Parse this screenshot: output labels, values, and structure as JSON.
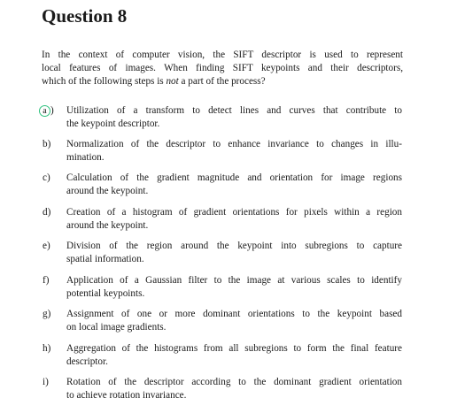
{
  "title": "Question 8",
  "question_lines": [
    "In the context of computer vision, the SIFT descriptor is used to represent",
    "local features of images. When finding SIFT keypoints and their descriptors,",
    "which of the following steps is ",
    "not",
    " a part of the process?"
  ],
  "selected_color": "#2ec27e",
  "options": [
    {
      "label": "a",
      "suffix": ")",
      "selected": true,
      "lines": [
        "Utilization of a transform to detect lines and curves that contribute to",
        "the keypoint descriptor."
      ]
    },
    {
      "label": "b)",
      "lines": [
        "Normalization of the descriptor to enhance invariance to changes in illu-",
        "mination."
      ]
    },
    {
      "label": "c)",
      "lines": [
        "Calculation of the gradient magnitude and orientation for image regions",
        "around the keypoint."
      ]
    },
    {
      "label": "d)",
      "lines": [
        "Creation of a histogram of gradient orientations for pixels within a region",
        "around the keypoint."
      ]
    },
    {
      "label": "e)",
      "lines": [
        "Division of the region around the keypoint into subregions to capture",
        "spatial information."
      ]
    },
    {
      "label": "f)",
      "lines": [
        "Application of a Gaussian filter to the image at various scales to identify",
        "potential keypoints."
      ]
    },
    {
      "label": "g)",
      "lines": [
        "Assignment of one or more dominant orientations to the keypoint based",
        "on local image gradients."
      ]
    },
    {
      "label": "h)",
      "lines": [
        "Aggregation of the histograms from all subregions to form the final feature",
        "descriptor."
      ]
    },
    {
      "label": "i)",
      "lines": [
        "Rotation of the descriptor according to the dominant gradient orientation",
        "to achieve rotation invariance."
      ]
    }
  ]
}
